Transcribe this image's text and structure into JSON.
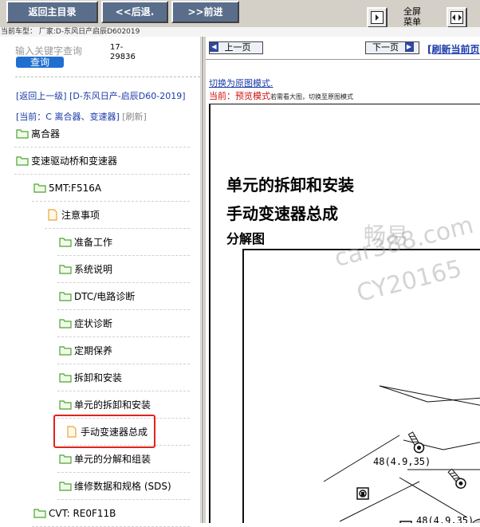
{
  "toolbar": {
    "home_label": "返回主目录",
    "back_label": "<<后退.",
    "forward_label": ">>前进",
    "fullscreen_label_line1": "全屏",
    "fullscreen_label_line2": "菜单"
  },
  "carline": "当前车型： 厂家:D-东风日产启辰D602019",
  "search": {
    "placeholder": "输入关键字查询",
    "code": "17-29836",
    "button_label": "查询"
  },
  "breadcrumb": {
    "back_text": "[返回上一级]  [D-东风日产-启辰D60-2019]",
    "current_prefix": "[当前：",
    "current_value": "C 离合器、变速器]",
    "refresh": "[刷新]"
  },
  "tree": [
    {
      "label": "离合器",
      "type": "folder"
    },
    {
      "label": "变速驱动桥和变速器",
      "type": "folder"
    },
    {
      "label": "5MT:F516A",
      "type": "folder"
    },
    {
      "label": "注意事项",
      "type": "doc"
    },
    {
      "label": "准备工作",
      "type": "folder"
    },
    {
      "label": "系统说明",
      "type": "folder"
    },
    {
      "label": "DTC/电路诊断",
      "type": "folder"
    },
    {
      "label": "症状诊断",
      "type": "folder"
    },
    {
      "label": "定期保养",
      "type": "folder"
    },
    {
      "label": "拆卸和安装",
      "type": "folder"
    },
    {
      "label": "单元的拆卸和安装",
      "type": "folder"
    },
    {
      "label": "手动变速器总成",
      "type": "doc",
      "selected": true
    },
    {
      "label": "单元的分解和组装",
      "type": "folder"
    },
    {
      "label": "维修数据和规格 (SDS)",
      "type": "folder"
    },
    {
      "label": "CVT: RE0F11B",
      "type": "folder"
    }
  ],
  "content": {
    "prev_label": "上一页",
    "next_label": "下一页",
    "refresh_label": "[刷新当前页",
    "switch_link": "切换为原图模式.",
    "mode_prefix": "当前：",
    "mode_value": "预览模式",
    "mode_hint": "若需看大图，切换至原图模式",
    "title1": "单元的拆卸和安装",
    "title2": "手动变速器总成",
    "title3": "分解图",
    "watermark1": "畅易",
    "watermark2": "car388.com",
    "watermark3": "CY20165",
    "torque1": "48(4.9,35)",
    "torque2": "48(4.9,35)"
  },
  "colors": {
    "toolbar_button": "#5a6e8c",
    "link": "#1a3aa8",
    "highlight": "#e0231c",
    "search_button": "#1f6fd1"
  }
}
